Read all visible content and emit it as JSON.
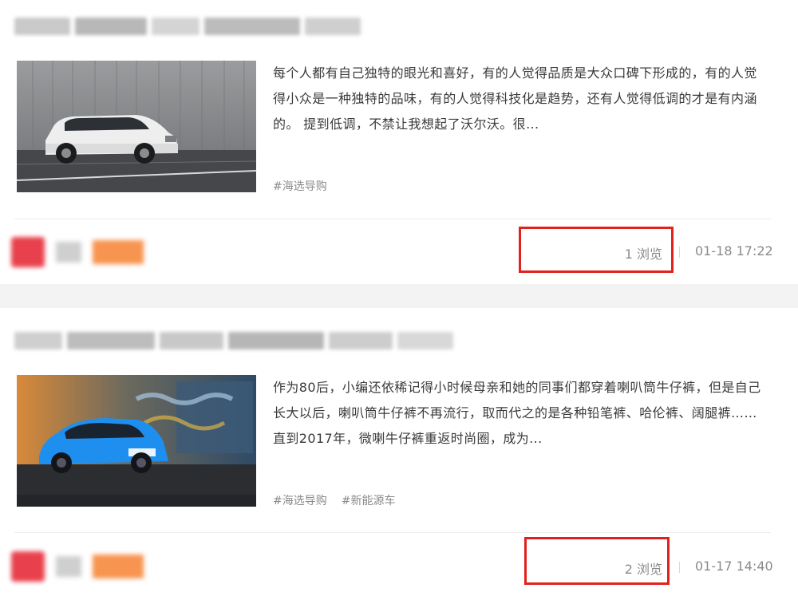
{
  "articles": [
    {
      "summary": "每个人都有自己独特的眼光和喜好，有的人觉得品质是大众口碑下形成的，有的人觉得小众是一种独特的品味，有的人觉得科技化是趋势，还有人觉得低调的才是有内涵的。 提到低调，不禁让我想起了沃尔沃。很...",
      "tags": [
        "#海选导购"
      ],
      "views": "1 浏览",
      "time": "01-18 17:22",
      "thumb_colors": {
        "wall": "#8d8f91",
        "ground": "#4a4b4e",
        "car": "#f2f2f2"
      }
    },
    {
      "summary": "作为80后，小编还依稀记得小时候母亲和她的同事们都穿着喇叭筒牛仔裤，但是自己长大以后，喇叭筒牛仔裤不再流行，取而代之的是各种铅笔裤、哈伦裤、阔腿裤……直到2017年，微喇牛仔裤重返时尚圈，成为...",
      "tags": [
        "#海选导购",
        "#新能源车"
      ],
      "views": "2 浏览",
      "time": "01-17 14:40",
      "thumb_colors": {
        "wall": "#3f4f63",
        "ground": "#2a2c30",
        "car": "#1e90ff"
      }
    }
  ],
  "highlight_color": "#e2211c"
}
